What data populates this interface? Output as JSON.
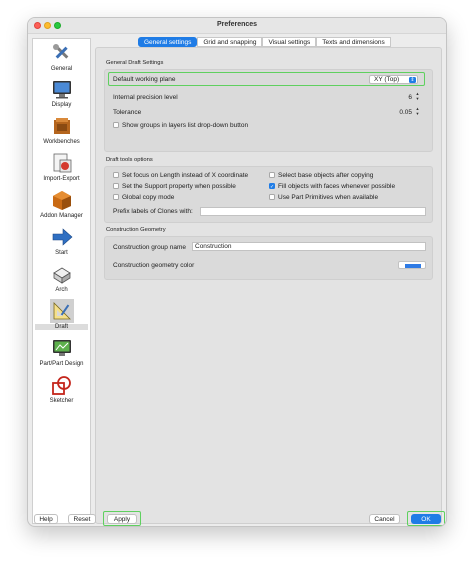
{
  "window": {
    "title": "Preferences"
  },
  "sidebar": {
    "items": [
      {
        "label": "General",
        "icon": "general-tools-icon"
      },
      {
        "label": "Display",
        "icon": "display-monitor-icon"
      },
      {
        "label": "Workbenches",
        "icon": "workbenches-icon"
      },
      {
        "label": "Import-Export",
        "icon": "import-export-icon"
      },
      {
        "label": "Addon Manager",
        "icon": "addon-manager-icon"
      },
      {
        "label": "Start",
        "icon": "start-arrow-icon"
      },
      {
        "label": "Arch",
        "icon": "arch-icon"
      },
      {
        "label": "Draft",
        "icon": "draft-icon",
        "selected": true
      },
      {
        "label": "Part/Part Design",
        "icon": "part-design-icon"
      },
      {
        "label": "Sketcher",
        "icon": "sketcher-icon"
      }
    ]
  },
  "tabs": [
    {
      "label": "General settings",
      "active": true
    },
    {
      "label": "Grid and snapping"
    },
    {
      "label": "Visual settings"
    },
    {
      "label": "Texts and dimensions"
    }
  ],
  "general": {
    "title": "General Draft Settings",
    "working_plane_label": "Default working plane",
    "working_plane_value": "XY (Top)",
    "precision_label": "Internal precision level",
    "precision_value": "6",
    "tolerance_label": "Tolerance",
    "tolerance_value": "0.05",
    "show_groups_label": "Show groups in layers list drop-down button"
  },
  "tools": {
    "title": "Draft tools options",
    "options": [
      {
        "label": "Set focus on Length instead of X coordinate",
        "checked": false
      },
      {
        "label": "Select base objects after copying",
        "checked": false
      },
      {
        "label": "Set the Support property when possible",
        "checked": false
      },
      {
        "label": "Fill objects with faces whenever possible",
        "checked": true
      },
      {
        "label": "Global copy mode",
        "checked": false
      },
      {
        "label": "Use Part Primitives when available",
        "checked": false
      }
    ],
    "prefix_label": "Prefix labels of Clones with:",
    "prefix_value": ""
  },
  "construction": {
    "title": "Construction Geometry",
    "group_name_label": "Construction group name",
    "group_name_value": "Construction",
    "color_label": "Construction geometry color",
    "color_value": "#2f7be5"
  },
  "footer": {
    "help": "Help",
    "reset": "Reset",
    "apply": "Apply",
    "cancel": "Cancel",
    "ok": "OK"
  },
  "colors": {
    "accent": "#1f7ce6",
    "highlight": "#5fd05f"
  }
}
